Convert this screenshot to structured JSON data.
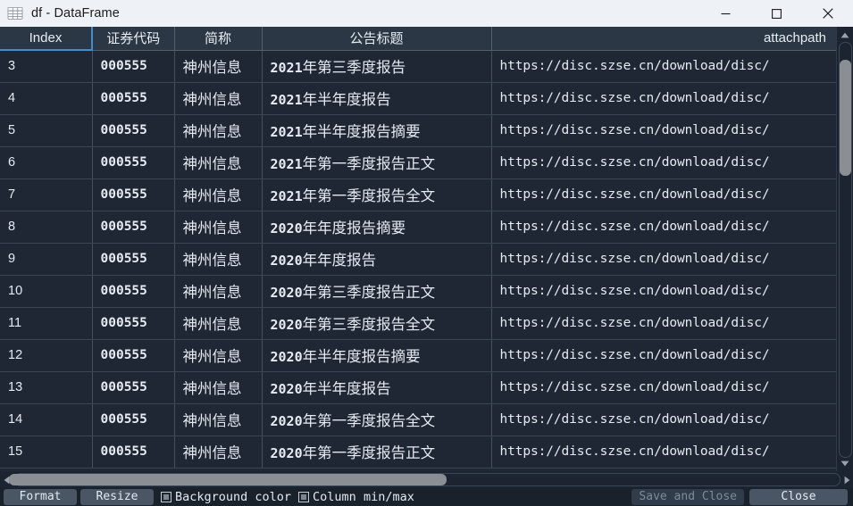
{
  "window": {
    "title": "df - DataFrame",
    "icon": "table-grid-icon",
    "controls": {
      "minimize": "minimize-icon",
      "maximize": "maximize-icon",
      "close": "close-icon"
    }
  },
  "table": {
    "columns": [
      "Index",
      "证券代码",
      "简称",
      "公告标题",
      "attachpath"
    ],
    "active_column": "Index",
    "rows": [
      {
        "index": "3",
        "code": "000555",
        "name": "神州信息",
        "title_num": "2021",
        "title_rest": "年第三季度报告",
        "path": "https://disc.szse.cn/download/disc/"
      },
      {
        "index": "4",
        "code": "000555",
        "name": "神州信息",
        "title_num": "2021",
        "title_rest": "年半年度报告",
        "path": "https://disc.szse.cn/download/disc/"
      },
      {
        "index": "5",
        "code": "000555",
        "name": "神州信息",
        "title_num": "2021",
        "title_rest": "年半年度报告摘要",
        "path": "https://disc.szse.cn/download/disc/"
      },
      {
        "index": "6",
        "code": "000555",
        "name": "神州信息",
        "title_num": "2021",
        "title_rest": "年第一季度报告正文",
        "path": "https://disc.szse.cn/download/disc/"
      },
      {
        "index": "7",
        "code": "000555",
        "name": "神州信息",
        "title_num": "2021",
        "title_rest": "年第一季度报告全文",
        "path": "https://disc.szse.cn/download/disc/"
      },
      {
        "index": "8",
        "code": "000555",
        "name": "神州信息",
        "title_num": "2020",
        "title_rest": "年年度报告摘要",
        "path": "https://disc.szse.cn/download/disc/"
      },
      {
        "index": "9",
        "code": "000555",
        "name": "神州信息",
        "title_num": "2020",
        "title_rest": "年年度报告",
        "path": "https://disc.szse.cn/download/disc/"
      },
      {
        "index": "10",
        "code": "000555",
        "name": "神州信息",
        "title_num": "2020",
        "title_rest": "年第三季度报告正文",
        "path": "https://disc.szse.cn/download/disc/"
      },
      {
        "index": "11",
        "code": "000555",
        "name": "神州信息",
        "title_num": "2020",
        "title_rest": "年第三季度报告全文",
        "path": "https://disc.szse.cn/download/disc/"
      },
      {
        "index": "12",
        "code": "000555",
        "name": "神州信息",
        "title_num": "2020",
        "title_rest": "年半年度报告摘要",
        "path": "https://disc.szse.cn/download/disc/"
      },
      {
        "index": "13",
        "code": "000555",
        "name": "神州信息",
        "title_num": "2020",
        "title_rest": "年半年度报告",
        "path": "https://disc.szse.cn/download/disc/"
      },
      {
        "index": "14",
        "code": "000555",
        "name": "神州信息",
        "title_num": "2020",
        "title_rest": "年第一季度报告全文",
        "path": "https://disc.szse.cn/download/disc/"
      },
      {
        "index": "15",
        "code": "000555",
        "name": "神州信息",
        "title_num": "2020",
        "title_rest": "年第一季度报告正文",
        "path": "https://disc.szse.cn/download/disc/"
      }
    ]
  },
  "toolbar": {
    "format_label": "Format",
    "resize_label": "Resize",
    "background_color_label": "Background color",
    "column_minmax_label": "Column min/max",
    "background_color_checked": true,
    "column_minmax_checked": true,
    "save_and_close_label": "Save and Close",
    "save_and_close_enabled": false,
    "close_label": "Close"
  },
  "colors": {
    "accent": "#3e8ed0",
    "titlebar_bg": "#eef1f5",
    "grid_bg": "#1e2733",
    "header_bg": "#2b3745",
    "index_bg": "#252f3d",
    "scrollbar_thumb": "#8b8f93"
  }
}
